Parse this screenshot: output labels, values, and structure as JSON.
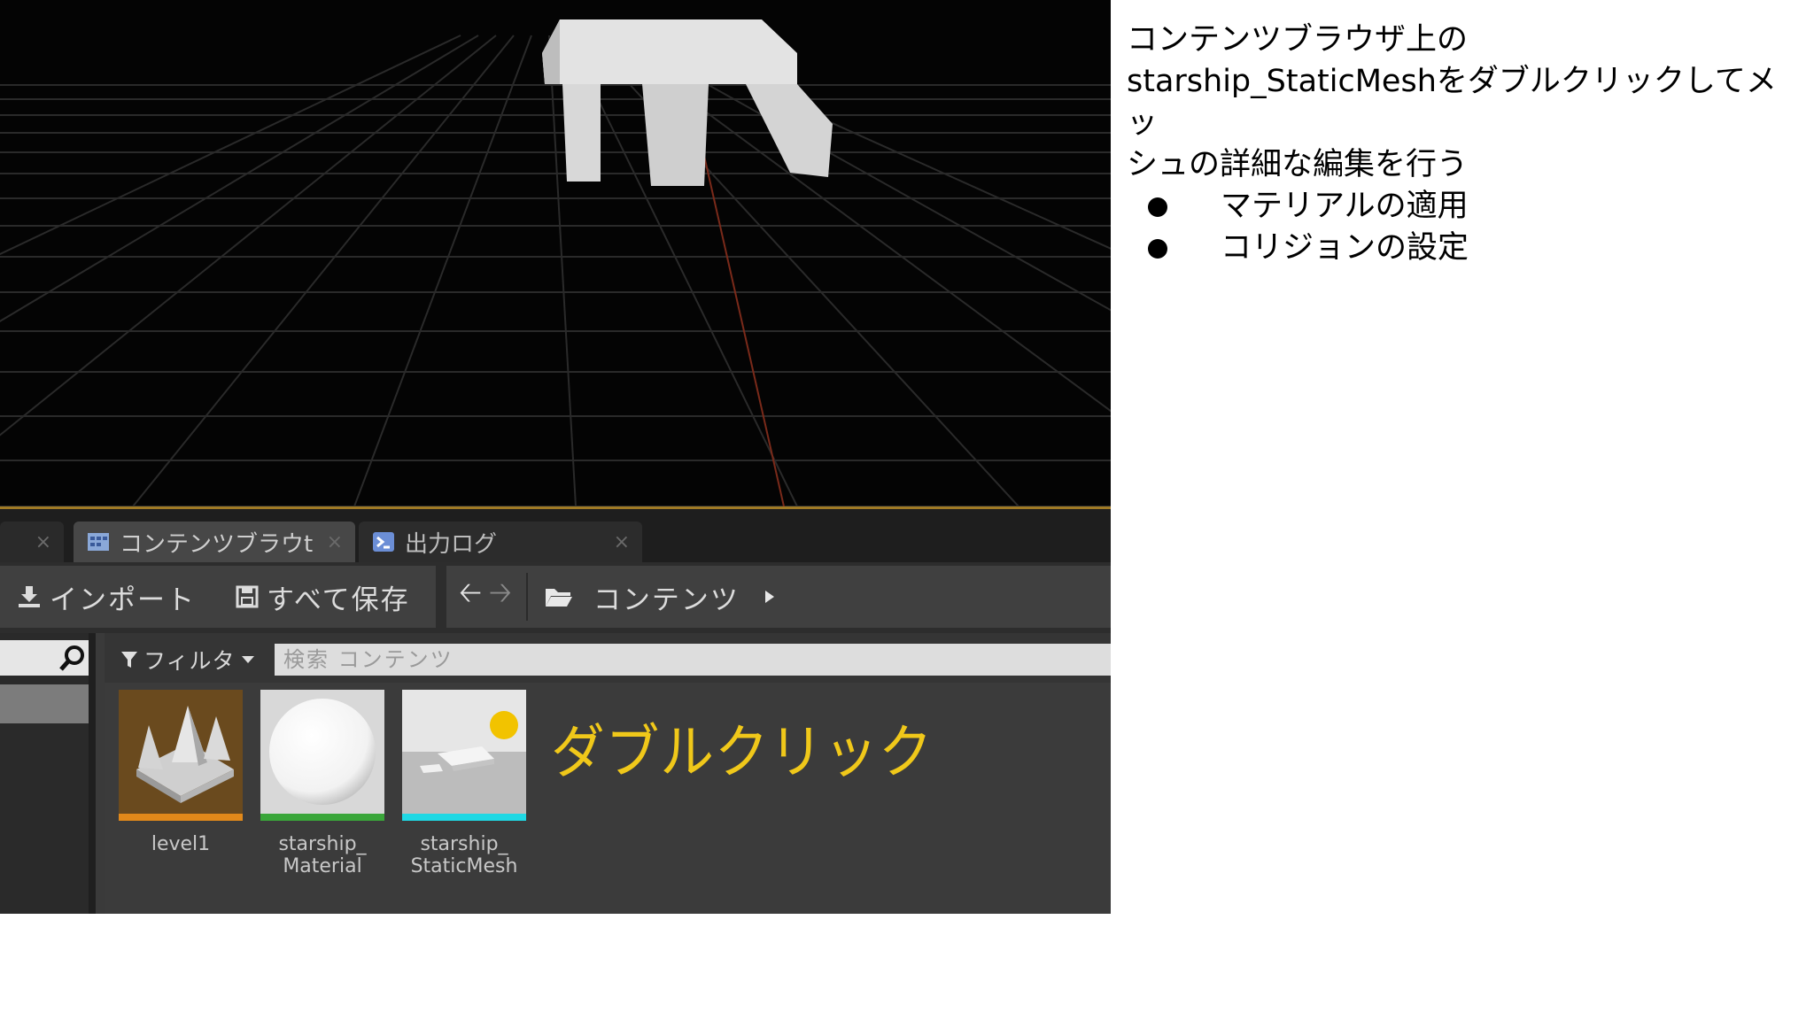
{
  "tabs": [
    {
      "label": "",
      "close": "×"
    },
    {
      "label": "コンテンツブラウt",
      "close": "×"
    },
    {
      "label": "出力ログ",
      "close": "×"
    }
  ],
  "toolbar": {
    "import_label": "インポート",
    "save_all_label": "すべて保存",
    "breadcrumb": "コンテンツ"
  },
  "filter": {
    "label": "フィルタ",
    "search_placeholder": "検索 コンテンツ"
  },
  "assets": [
    {
      "label_line1": "level1",
      "label_line2": "",
      "accent": "#e2891a"
    },
    {
      "label_line1": "starship_",
      "label_line2": "Material",
      "accent": "#3aa63a"
    },
    {
      "label_line1": "starship_",
      "label_line2": "StaticMesh",
      "accent": "#1fd8e4"
    }
  ],
  "callout": "ダブルクリック",
  "notes": {
    "line1": "コンテンツブラウザ上の",
    "line2": "starship_StaticMeshをダブルクリックしてメッ",
    "line3": "シュの詳細な編集を行う",
    "bullets": [
      "マテリアルの適用",
      "コリジョンの設定"
    ]
  },
  "colors": {
    "callout": "#f0c81a",
    "viewport_border": "#a07a25"
  }
}
